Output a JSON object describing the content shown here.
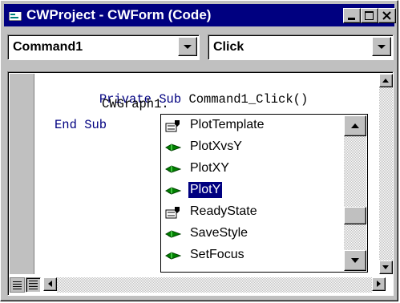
{
  "window": {
    "title": "CWProject - CWForm (Code)"
  },
  "object_combo": {
    "value": "Command1"
  },
  "procedure_combo": {
    "value": "Click"
  },
  "code": {
    "line1_kw": "Private Sub",
    "line1_rest": " Command1_Click()",
    "line2": "CWGraph1.",
    "line3": "End Sub"
  },
  "autocomplete": {
    "items": [
      {
        "label": "PlotTemplate",
        "icon": "property-icon"
      },
      {
        "label": "PlotXvsY",
        "icon": "method-icon"
      },
      {
        "label": "PlotXY",
        "icon": "method-icon"
      },
      {
        "label": "PlotY",
        "icon": "method-icon",
        "selected": true
      },
      {
        "label": "ReadyState",
        "icon": "property-icon"
      },
      {
        "label": "SaveStyle",
        "icon": "method-icon"
      },
      {
        "label": "SetFocus",
        "icon": "method-icon"
      }
    ]
  },
  "colors": {
    "titlebar": "#000080",
    "selection": "#000080",
    "keyword": "#000080",
    "face": "#c0c0c0"
  }
}
